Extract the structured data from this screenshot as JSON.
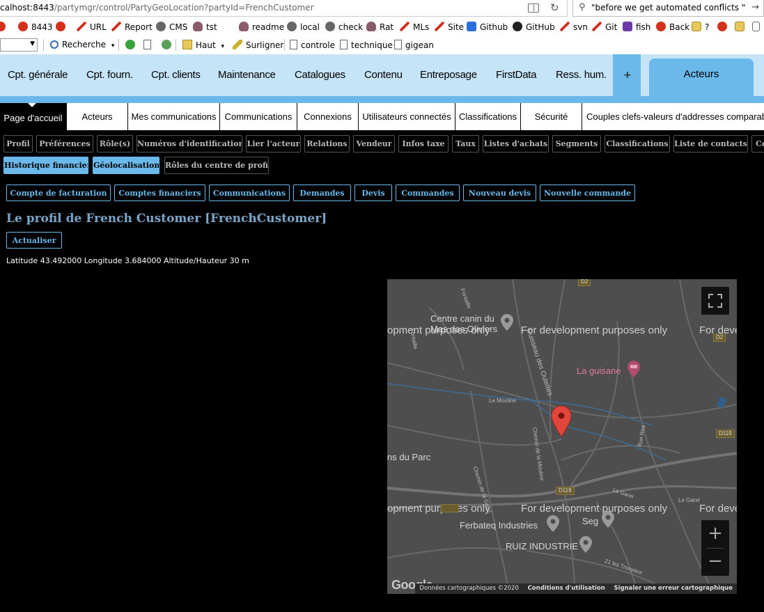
{
  "browser": {
    "url_host": "calhost:8443",
    "url_path": "/partymgr/control/PartyGeoLocation?partyId=FrenchCustomer",
    "search_text": "\"before we get automated conflicts \"",
    "bookmarks": [
      "8443",
      "URL",
      "Report",
      "CMS",
      "tst",
      "readme",
      "local",
      "check",
      "Rat",
      "MLs",
      "Site",
      "Github",
      "GitHub",
      "svn",
      "Git",
      "fish",
      "Back",
      "?"
    ],
    "toolbar": {
      "search_label": "Recherche",
      "haut_label": "Haut",
      "highlight_label": "Surligner",
      "controle_label": "controle",
      "technique_label": "technique",
      "gigean_label": "gigean"
    }
  },
  "topnav": {
    "items": [
      "Cpt. générale",
      "Cpt. fourn.",
      "Cpt. clients",
      "Maintenance",
      "Catalogues",
      "Contenu",
      "Entreposage",
      "FirstData",
      "Ress. hum."
    ],
    "plus": "+",
    "active": "Acteurs"
  },
  "tabs": [
    "Page d'accueil",
    "Acteurs",
    "Mes communications",
    "Communications",
    "Connexions",
    "Utilisateurs connectés",
    "Classifications",
    "Sécurité",
    "Couples clefs-valeurs d'addresses comparab"
  ],
  "subnav": {
    "row1": [
      "Profil",
      "Préférences",
      "Rôle(s)",
      "Numéros d'identification",
      "Lier l'acteur",
      "Relations",
      "Vendeur",
      "Infos taxe",
      "Taux",
      "Listes d'achats",
      "Segments",
      "Classifications",
      "Liste de contacts",
      "Co"
    ],
    "row2": [
      "Historique financier",
      "Géolocalisation",
      "Rôles du centre de profit"
    ]
  },
  "actions": [
    "Compte de facturation",
    "Comptes financiers",
    "Communications",
    "Demandes",
    "Devis",
    "Commandes",
    "Nouveau devis",
    "Nouvelle commande"
  ],
  "profile": {
    "title": "Le profil de French Customer [FrenchCustomer]",
    "refresh_label": "Actualiser",
    "coords_text": "Latitude 43.492000 Longitude 3.684000 Altitude/Hauteur 30 m"
  },
  "map": {
    "watermark": "For development purposes only",
    "watermark_left": "opment purposes only",
    "watermark_right": "For deve",
    "pois": [
      "Centre canin du Mas des Oliviers",
      "La guisane",
      "Ferbateq Industries",
      "Seg",
      "RUIZ INDUSTRIE",
      "ns du Parc"
    ],
    "roads": [
      "Le Mouline",
      "Ruisseau des Oulettes",
      "Chemin de la Mouline",
      "Rue Rea",
      "Le Garel",
      "Le Garel",
      "Chemin de la Garel",
      "21 les Trouyaux",
      "Fontaille",
      "Fontaille"
    ],
    "shields": [
      "D2",
      "D2",
      "D119",
      "D119"
    ],
    "google": "Google",
    "attribution": [
      "Données cartographiques ©2020",
      "Conditions d'utilisation",
      "Signaler une erreur cartographique"
    ],
    "zoom_in": "+",
    "zoom_out": "−",
    "marker_color": "#e2453c"
  },
  "colors": {
    "nav_bg": "#c5e4f7",
    "accent": "#6ab9ea",
    "title": "#7aa6c9"
  }
}
